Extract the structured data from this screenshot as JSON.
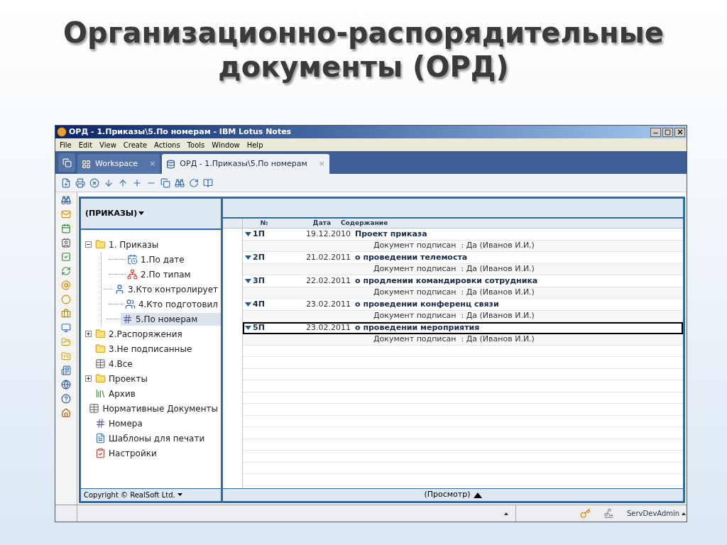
{
  "slide": {
    "title_lines": [
      "Организационно-распорядительные",
      "документы (ОРД)"
    ]
  },
  "window": {
    "title": "ОРД - 1.Приказы\\5.По номерам - IBM Lotus Notes"
  },
  "menu": [
    "File",
    "Edit",
    "View",
    "Create",
    "Actions",
    "Tools",
    "Window",
    "Help"
  ],
  "tabs": [
    {
      "label": "Workspace",
      "kind": "workspace",
      "selected": false,
      "close": "×"
    },
    {
      "label": "ОРД - 1.Приказы\\5.По номерам",
      "kind": "database",
      "selected": true,
      "close": "×"
    }
  ],
  "navigator": {
    "header": "(ПРИКАЗЫ)",
    "items": [
      {
        "label": "1. Приказы",
        "kind": "folder",
        "expanded": true,
        "selected": false,
        "children": [
          {
            "label": "1.По дате",
            "kind": "calendar",
            "selected": false
          },
          {
            "label": "2.По типам",
            "kind": "network",
            "selected": false
          },
          {
            "label": "3.Кто контролирует",
            "kind": "person",
            "selected": false
          },
          {
            "label": "4.Кто подготовил",
            "kind": "people",
            "selected": false
          },
          {
            "label": "5.По номерам",
            "kind": "number",
            "selected": true
          }
        ]
      },
      {
        "label": "2.Распоряжения",
        "kind": "folder",
        "expanded": false,
        "selected": false
      },
      {
        "label": "3.Не подписанные",
        "kind": "folder",
        "selected": false
      },
      {
        "label": "4.Все",
        "kind": "table",
        "selected": false
      },
      {
        "label": "Проекты",
        "kind": "folder",
        "expanded": false,
        "selected": false
      },
      {
        "label": "Архив",
        "kind": "books",
        "selected": false
      },
      {
        "label": "Нормативные Документы",
        "kind": "table",
        "selected": false
      },
      {
        "label": "Номера",
        "kind": "number",
        "selected": false
      },
      {
        "label": "Шаблоны для печати",
        "kind": "template",
        "selected": false
      },
      {
        "label": "Настройки",
        "kind": "settings",
        "selected": false
      }
    ],
    "footer": "Copyright © RealSoft Ltd."
  },
  "view": {
    "columns": [
      "№",
      "Дата",
      "Содержание"
    ],
    "rows": [
      {
        "number": "1П",
        "date": "19.12.2010",
        "title": "Проект приказа",
        "detail": "Документ подписан  : Да (Иванов И.И.)",
        "selected": false
      },
      {
        "number": "2П",
        "date": "21.02.2011",
        "title": "о проведении телемоста",
        "detail": "Документ подписан  : Да (Иванов И.И.)",
        "selected": false
      },
      {
        "number": "3П",
        "date": "22.02.2011",
        "title": "о продлении командировки сотрудника",
        "detail": "Документ подписан  : Да (Иванов И.И.)",
        "selected": false
      },
      {
        "number": "4П",
        "date": "23.02.2011",
        "title": "о проведении конференц связи",
        "detail": "Документ подписан  : Да (Иванов И.И.)",
        "selected": false
      },
      {
        "number": "5П",
        "date": "23.02.2011",
        "title": "о проведении мероприятия",
        "detail": "Документ подписан  : Да (Иванов И.И.)",
        "selected": true
      }
    ],
    "footer": "(Просмотр)"
  },
  "status_bar": {
    "user": "ServDevAdmin"
  }
}
